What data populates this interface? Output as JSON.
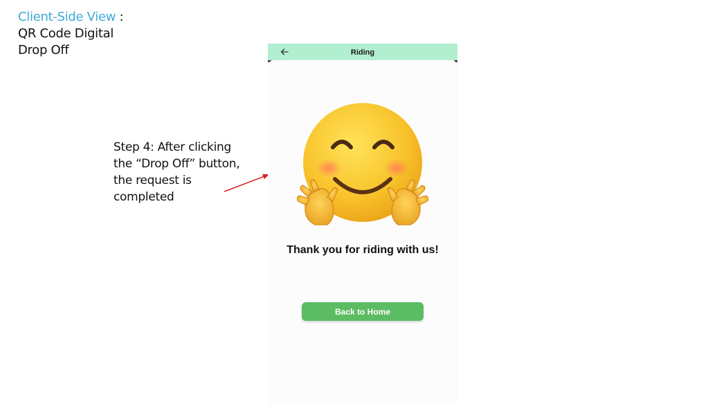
{
  "slide": {
    "title_accent": "Client-Side View",
    "title_colon": " :",
    "title_line2": "QR Code Digital",
    "title_line3": "Drop Off"
  },
  "annotation": {
    "line1": "Step 4: After clicking",
    "line2": "the “Drop Off” button,",
    "line3": "the request is",
    "line4": "completed"
  },
  "app": {
    "header_title": "Riding",
    "message": "Thank you for riding with us!",
    "button_label": "Back to Home"
  },
  "colors": {
    "accent_text": "#3fa9d6",
    "header_bg": "#b2efd0",
    "button_bg": "#5cbc63",
    "arrow": "#e02020"
  },
  "icons": {
    "back": "arrow-left-icon",
    "emoji": "hugging-face-emoji"
  }
}
